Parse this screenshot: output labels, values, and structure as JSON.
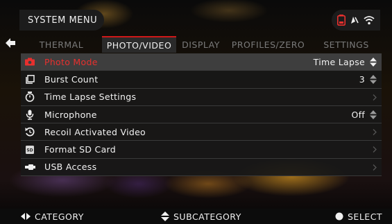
{
  "header": {
    "title": "SYSTEM MENU",
    "status_icons": [
      "battery-icon",
      "compass-icon",
      "wifi-icon"
    ],
    "battery_color": "#e8302e"
  },
  "tabs": [
    {
      "label": "THERMAL",
      "active": false
    },
    {
      "label": "PHOTO/VIDEO",
      "active": true
    },
    {
      "label": "DISPLAY",
      "active": false
    },
    {
      "label": "PROFILES/ZERO",
      "active": false
    },
    {
      "label": "SETTINGS",
      "active": false
    }
  ],
  "menu": {
    "items": [
      {
        "label": "Photo Mode",
        "icon": "camera-icon",
        "value": "Time Lapse",
        "control": "updown",
        "selected": true
      },
      {
        "label": "Burst Count",
        "icon": "burst-icon",
        "value": "3",
        "control": "updown",
        "selected": false
      },
      {
        "label": "Time Lapse Settings",
        "icon": "timer-icon",
        "value": "",
        "control": "chevron",
        "selected": false
      },
      {
        "label": "Microphone",
        "icon": "microphone-icon",
        "value": "Off",
        "control": "updown",
        "selected": false
      },
      {
        "label": "Recoil Activated Video",
        "icon": "recoil-icon",
        "value": "",
        "control": "chevron",
        "selected": false
      },
      {
        "label": "Format SD Card",
        "icon": "sd-card-icon",
        "value": "",
        "control": "chevron",
        "selected": false
      },
      {
        "label": "USB Access",
        "icon": "usb-icon",
        "value": "",
        "control": "chevron",
        "selected": false
      }
    ]
  },
  "footer": {
    "category": "CATEGORY",
    "subcategory": "SUBCATEGORY",
    "select": "SELECT"
  },
  "colors": {
    "accent": "#d01818",
    "selected_label": "#e8302e"
  }
}
